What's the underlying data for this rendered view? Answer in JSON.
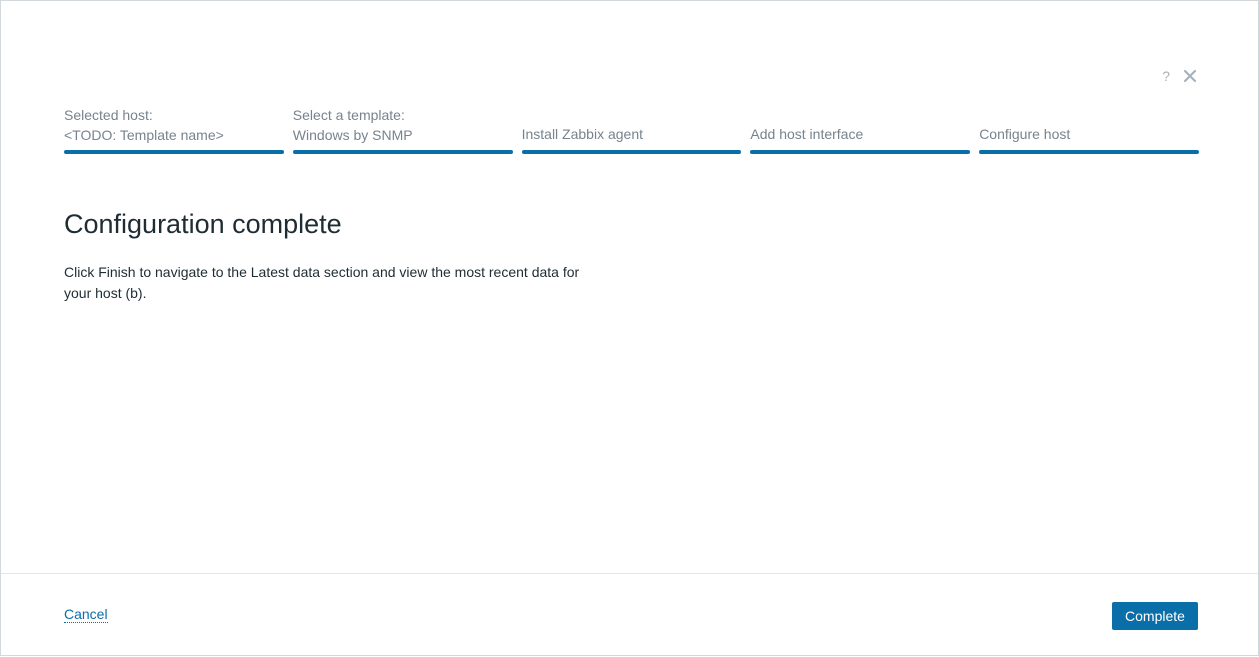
{
  "dialog": {
    "help_symbol": "?",
    "close_icon": "close-icon"
  },
  "steps": [
    {
      "line1": "Selected host:",
      "line2": "<TODO: Template name>"
    },
    {
      "line1": "Select a template:",
      "line2": "Windows by SNMP"
    },
    {
      "line1": "",
      "line2": "Install Zabbix agent"
    },
    {
      "line1": "",
      "line2": "Add host interface"
    },
    {
      "line1": "",
      "line2": "Configure host"
    }
  ],
  "main": {
    "title": "Configuration complete",
    "description": "Click Finish to navigate to the Latest data section and view the most recent data for your host (b)."
  },
  "footer": {
    "cancel_label": "Cancel",
    "complete_label": "Complete"
  },
  "colors": {
    "accent": "#0a6ea8",
    "muted_text": "#77838e",
    "text": "#1f2c33"
  }
}
